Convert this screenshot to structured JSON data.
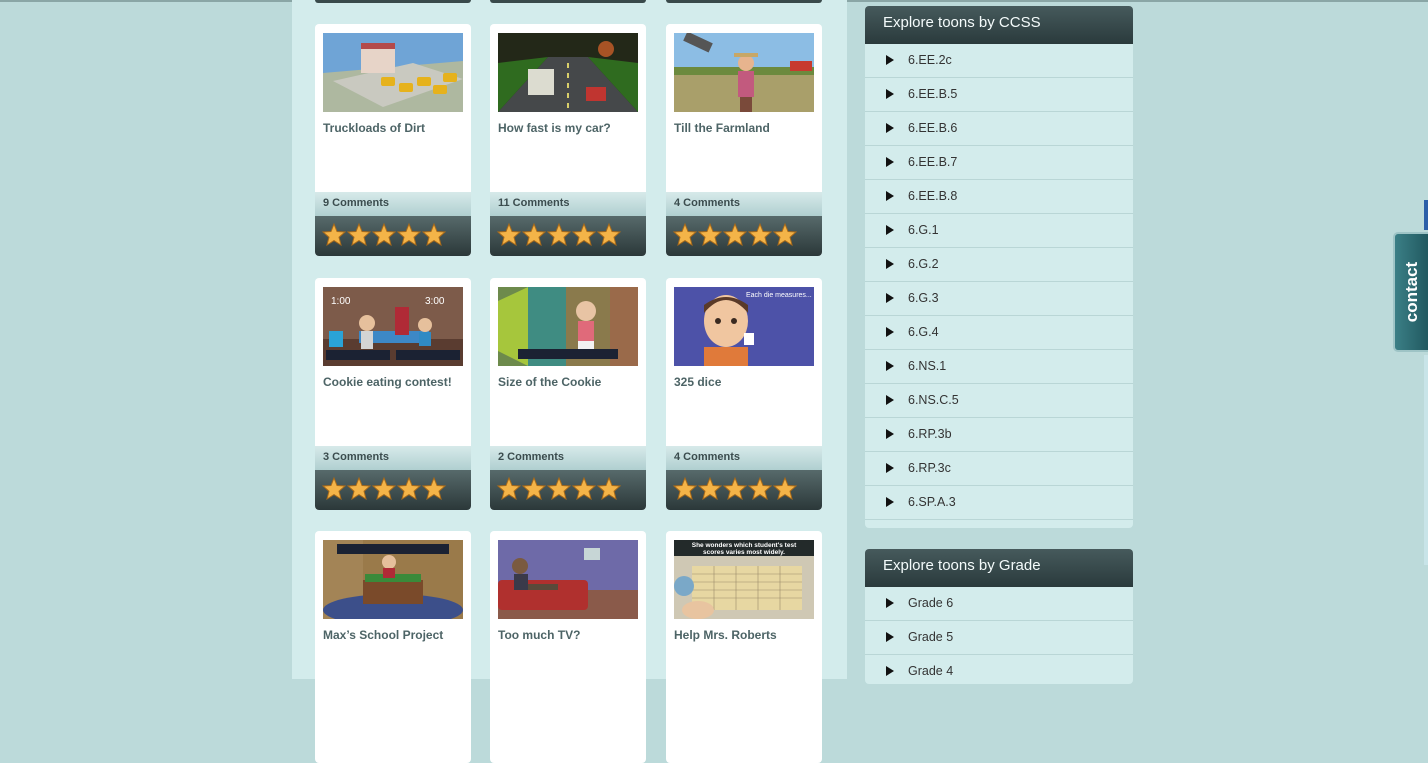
{
  "cards": [
    {
      "title": "Truckloads of Dirt",
      "comments": "9 Comments",
      "rating": 5
    },
    {
      "title": "How fast is my car?",
      "comments": "11 Comments",
      "rating": 5
    },
    {
      "title": "Till the Farmland",
      "comments": "4 Comments",
      "rating": 5
    },
    {
      "title": "Cookie eating contest!",
      "comments": "3 Comments",
      "rating": 5
    },
    {
      "title": "Size of the Cookie",
      "comments": "2 Comments",
      "rating": 5
    },
    {
      "title": "325 dice",
      "comments": "4 Comments",
      "rating": 5
    },
    {
      "title": "Max’s School Project",
      "comments": "",
      "rating": null
    },
    {
      "title": "Too much TV?",
      "comments": "",
      "rating": null
    },
    {
      "title": "Help Mrs. Roberts",
      "comments": "",
      "rating": null
    }
  ],
  "thumb_text": {
    "cookie_timer_left": "1:00",
    "cookie_timer_right": "3:00",
    "dice_caption": "Each die measures...",
    "roberts_caption_1": "She wonders which student's test",
    "roberts_caption_2": "scores varies most widely."
  },
  "ccss_panel": {
    "title": "Explore toons by CCSS",
    "items": [
      "6.EE.2c",
      "6.EE.B.5",
      "6.EE.B.6",
      "6.EE.B.7",
      "6.EE.B.8",
      "6.G.1",
      "6.G.2",
      "6.G.3",
      "6.G.4",
      "6.NS.1",
      "6.NS.C.5",
      "6.RP.3b",
      "6.RP.3c",
      "6.SP.A.3"
    ]
  },
  "grade_panel": {
    "title": "Explore toons by Grade",
    "items": [
      "Grade 6",
      "Grade 5",
      "Grade 4"
    ]
  },
  "contact": {
    "label": "contact"
  },
  "colors": {
    "page_bg": "#bcdada",
    "column_bg": "#d3ecec",
    "header_dark": "#2a3a3c",
    "star": "#f4b448",
    "contact_tab": "#215960"
  }
}
